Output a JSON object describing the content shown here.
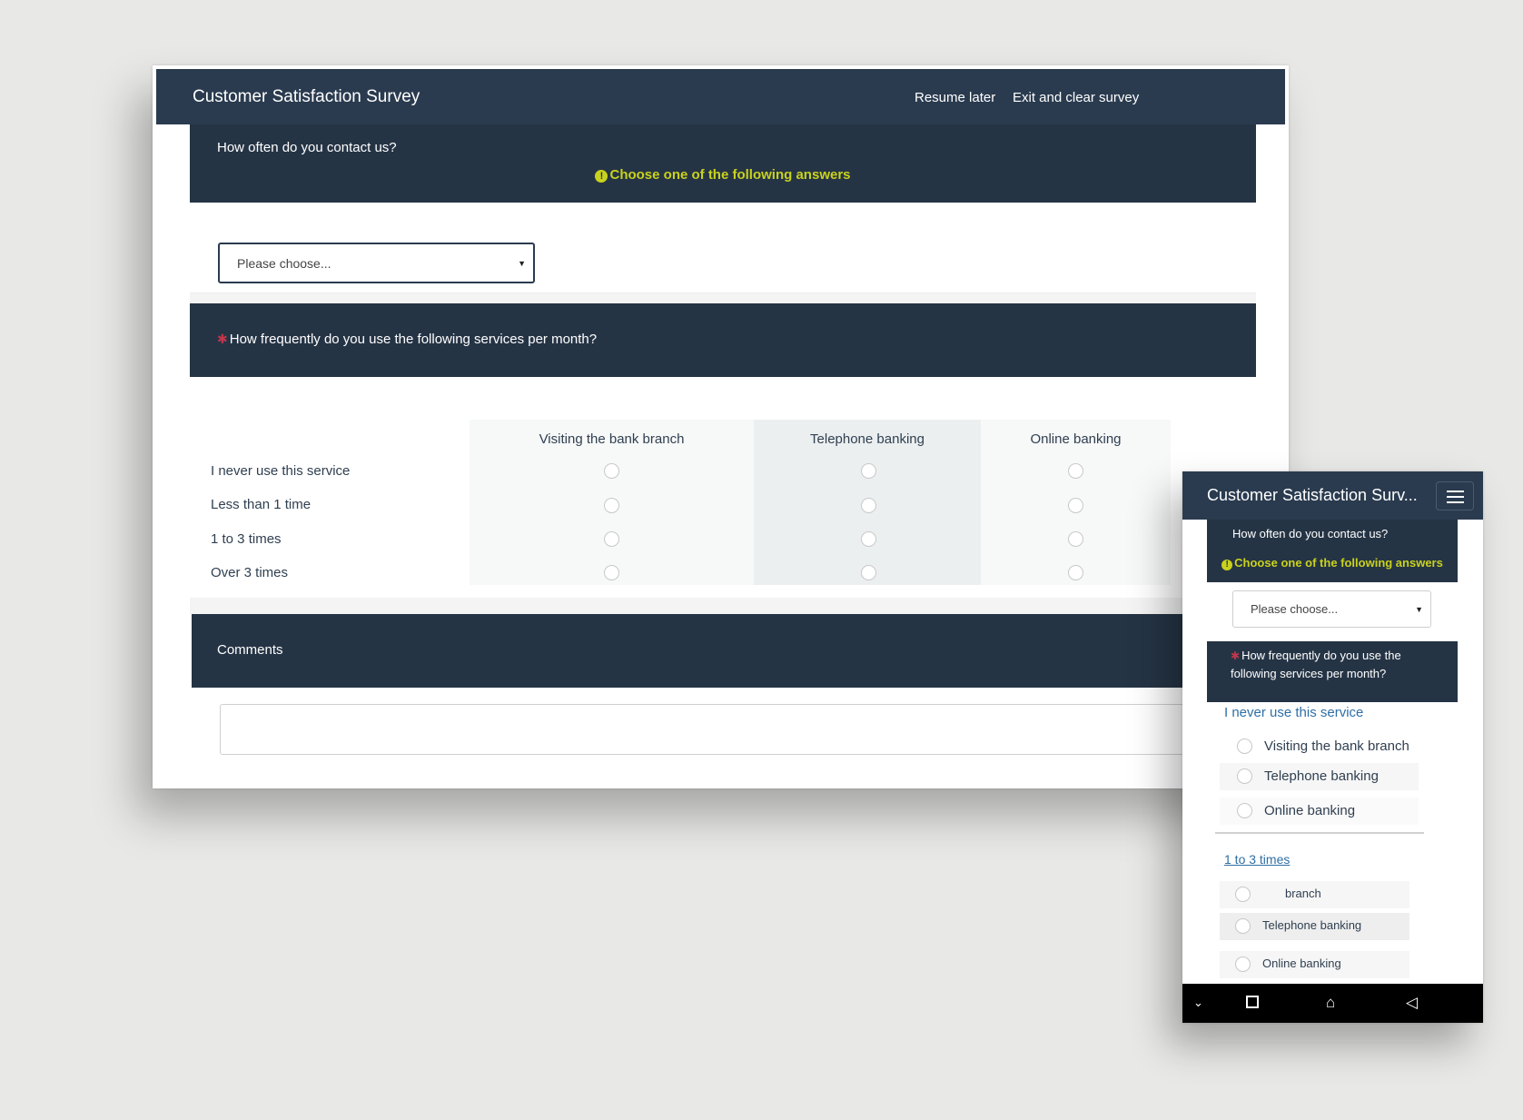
{
  "desktop": {
    "nav": {
      "title": "Customer Satisfaction Survey",
      "resume_label": "Resume later",
      "exit_label": "Exit and clear survey"
    },
    "q1": {
      "question": "How often do you contact us?",
      "hint": "Choose one of the following answers",
      "select_value": "Please choose..."
    },
    "q2": {
      "question": "How frequently do you use the following services per month?",
      "columns": [
        "Visiting the bank branch",
        "Telephone banking",
        "Online banking"
      ],
      "rows": [
        "I never use this service",
        "Less than 1 time",
        "1 to 3 times",
        "Over 3 times"
      ]
    },
    "q3": {
      "question": "Comments"
    }
  },
  "mobile": {
    "nav": {
      "title": "Customer Satisfaction Surv..."
    },
    "q1": {
      "question": "How often do you contact us?",
      "hint": "Choose one of the following answers",
      "select_value": "Please choose..."
    },
    "q2": {
      "question": "How frequently do you use the following services per month?",
      "group1": {
        "label": "I never use this service",
        "options": [
          "Visiting the bank branch",
          "Telephone banking",
          "Online banking"
        ]
      },
      "group2": {
        "label": "1 to 3 times",
        "options": [
          "branch",
          "Telephone banking",
          "Online banking"
        ]
      }
    }
  },
  "icons": {
    "hint": "exclamation-circle-icon",
    "required": "asterisk-icon",
    "menu": "hamburger-menu-icon",
    "android_nav": [
      "chevron-down-icon",
      "square-icon",
      "home-icon",
      "back-triangle-icon"
    ]
  },
  "colors": {
    "header_bg": "#2a3b4f",
    "question_bg": "#253445",
    "hint": "#c9d21c",
    "required": "#c2364a",
    "mobile_group_label": "#2e6fa6"
  }
}
